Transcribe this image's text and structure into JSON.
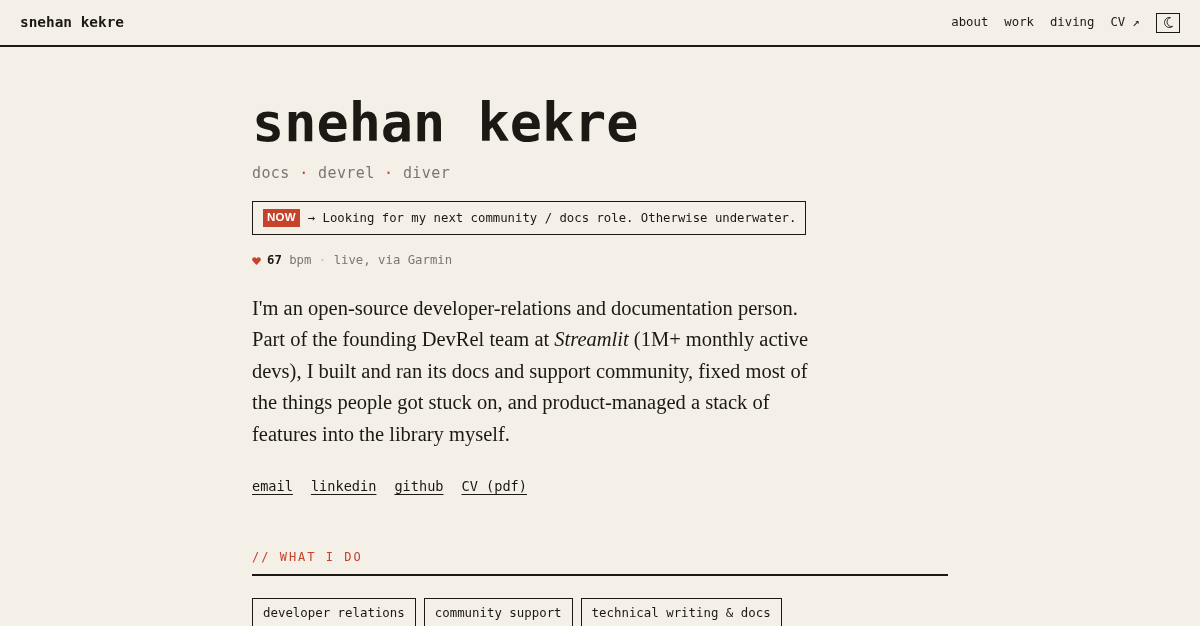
{
  "navbar": {
    "brand": "snehan kekre",
    "links": [
      "about",
      "work",
      "diving",
      "CV ↗"
    ]
  },
  "hero": {
    "title": "snehan kekre",
    "tagline": [
      "docs",
      "devrel",
      "diver"
    ],
    "tagline_separator": "·",
    "now": {
      "badge": "NOW",
      "text": "→ Looking for my next community / docs role. Otherwise underwater."
    },
    "heart_rate": {
      "value": "67",
      "unit": "bpm",
      "separator": "·",
      "source": "live, via Garmin"
    },
    "bio": "I'm an open-source developer-relations and documentation person. Part of the founding DevRel team at *Streamlit* (1M+ monthly active devs), I built and ran its docs and support community, fixed most of the things people got stuck on, and product-managed a stack of features into the library myself.",
    "links": [
      "email",
      "linkedin",
      "github",
      "CV (pdf)"
    ]
  },
  "section": {
    "heading": "// WHAT I DO",
    "tags": [
      "developer relations",
      "community support",
      "technical writing & docs"
    ]
  }
}
